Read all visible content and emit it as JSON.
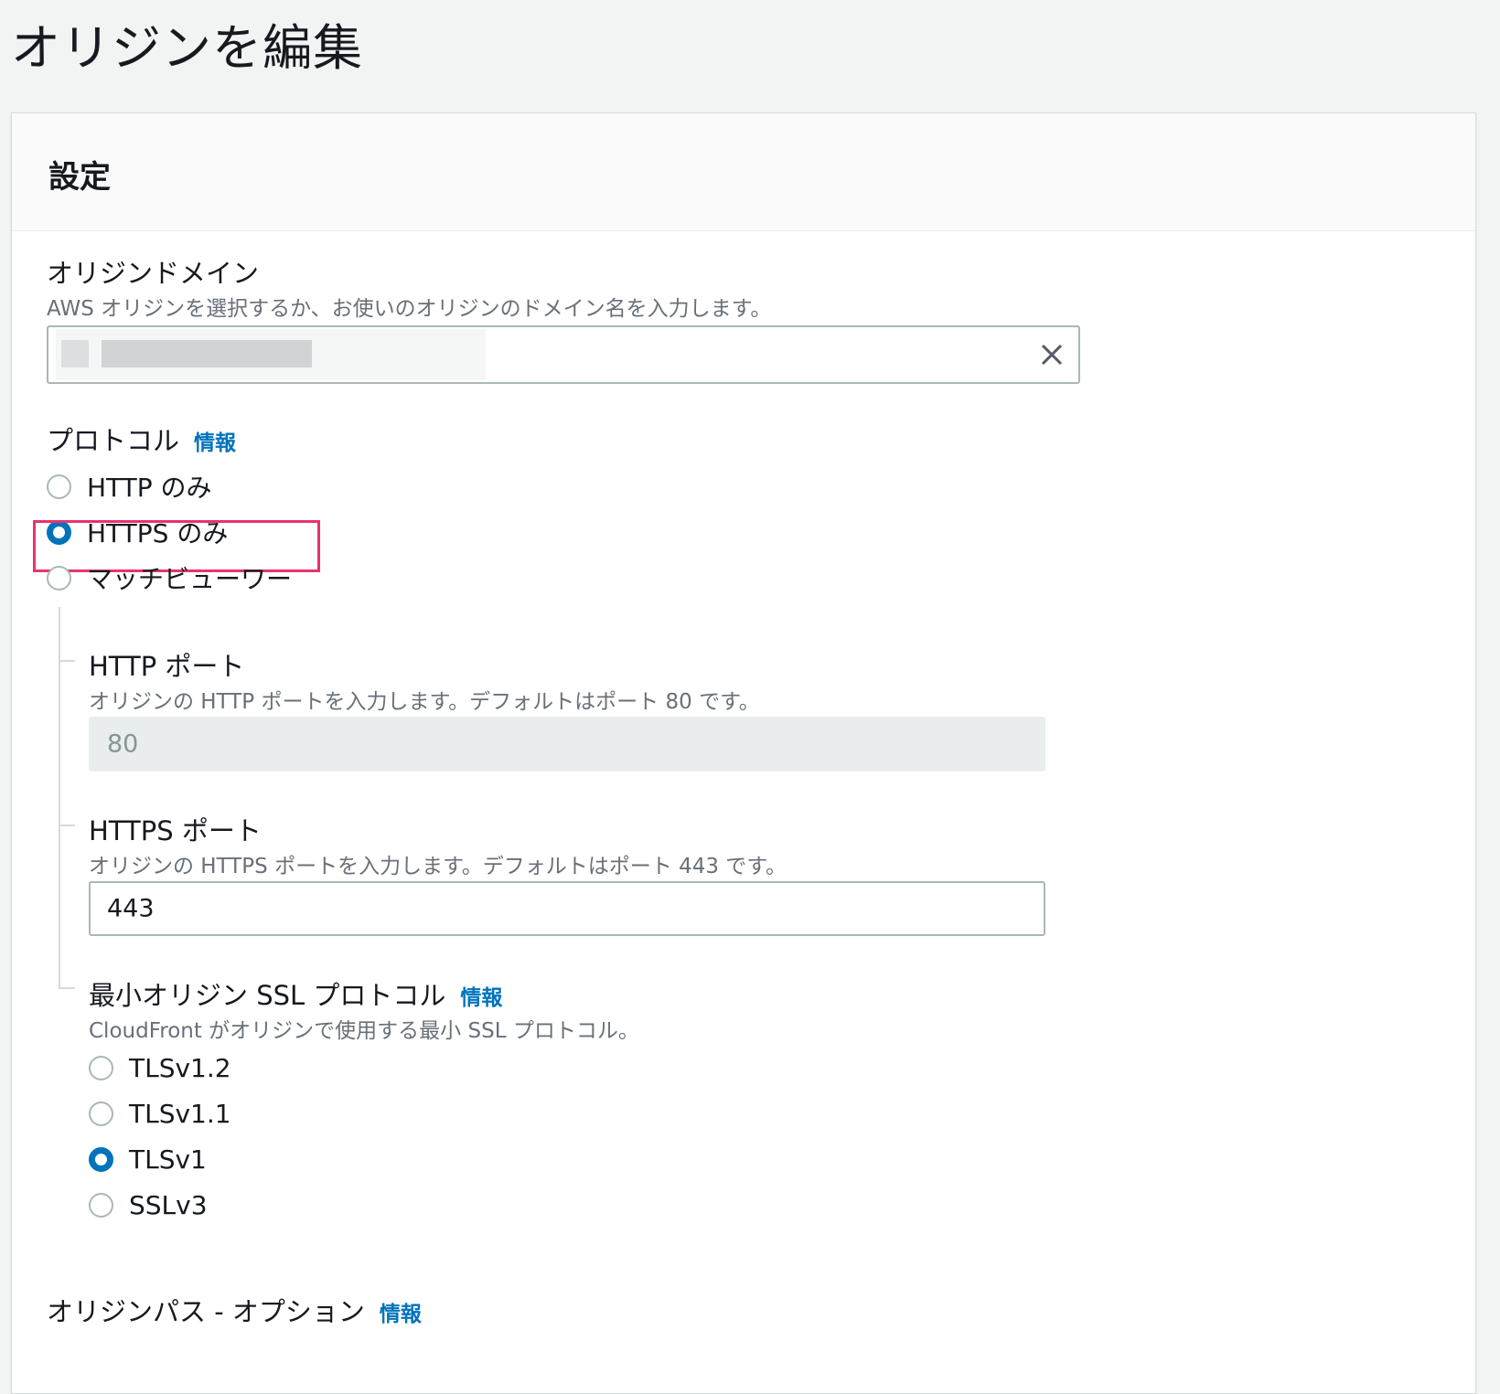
{
  "page": {
    "title": "オリジンを編集"
  },
  "panel": {
    "title": "設定"
  },
  "origin_domain": {
    "label": "オリジンドメイン",
    "description": "AWS オリジンを選択するか、お使いのオリジンのドメイン名を入力します。",
    "value_redacted": true,
    "clear_icon": "close-icon"
  },
  "protocol": {
    "label": "プロトコル",
    "info": "情報",
    "options": [
      {
        "label": "HTTP のみ",
        "selected": false
      },
      {
        "label": "HTTPS のみ",
        "selected": true
      },
      {
        "label": "マッチビューワー",
        "selected": false
      }
    ],
    "highlight_color": "#e8336d"
  },
  "http_port": {
    "label": "HTTP ポート",
    "description": "オリジンの HTTP ポートを入力します。デフォルトはポート 80 です。",
    "value": "80",
    "disabled": true
  },
  "https_port": {
    "label": "HTTPS ポート",
    "description": "オリジンの HTTPS ポートを入力します。デフォルトはポート 443 です。",
    "value": "443"
  },
  "min_ssl": {
    "label": "最小オリジン SSL プロトコル",
    "info": "情報",
    "description": "CloudFront がオリジンで使用する最小 SSL プロトコル。",
    "options": [
      {
        "label": "TLSv1.2",
        "selected": false
      },
      {
        "label": "TLSv1.1",
        "selected": false
      },
      {
        "label": "TLSv1",
        "selected": true
      },
      {
        "label": "SSLv3",
        "selected": false
      }
    ]
  },
  "origin_path": {
    "label": "オリジンパス - オプション",
    "info": "情報"
  },
  "colors": {
    "accent": "#0073bb",
    "background": "#f2f3f3"
  }
}
